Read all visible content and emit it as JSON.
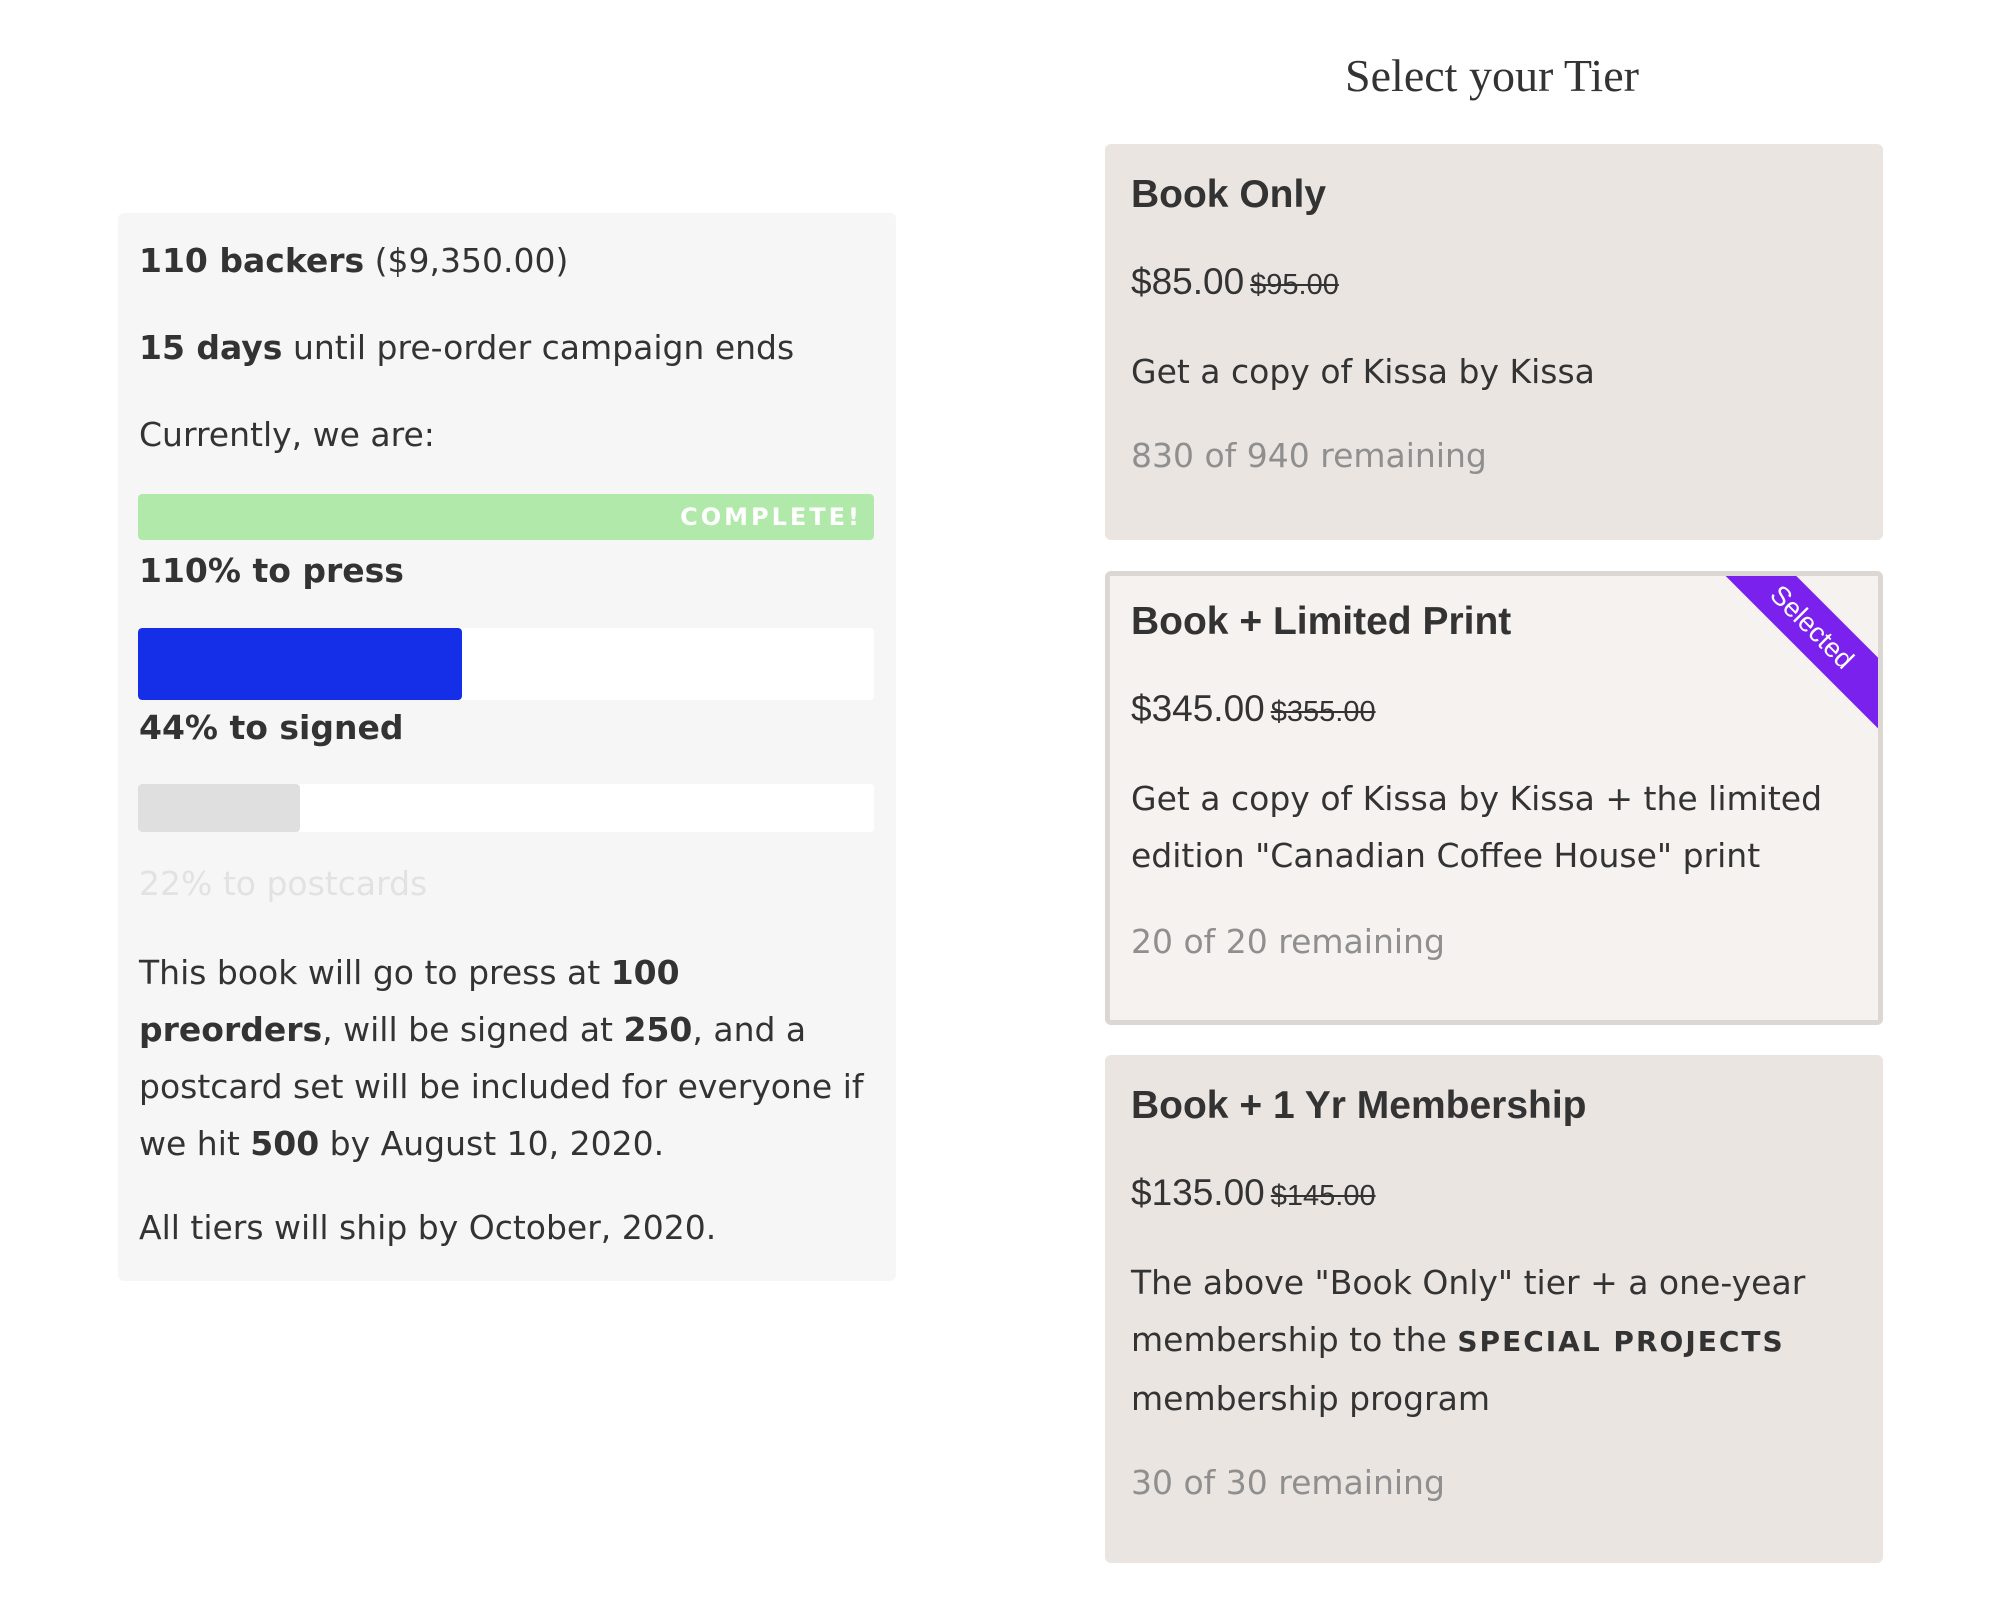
{
  "campaign": {
    "backers_count": "110 backers",
    "backers_amount": " ($9,350.00)",
    "days_count": "15 days",
    "days_text": " until pre-order campaign ends",
    "currently": "Currently, we are:",
    "progress": [
      {
        "id": "press",
        "caption": "110% to press",
        "percent": 110,
        "tag": "COMPLETE!",
        "color": "#b1e9ab"
      },
      {
        "id": "signed",
        "caption": "44% to signed",
        "percent": 44,
        "color": "#152ee8"
      },
      {
        "id": "postcards",
        "caption": "22% to postcards",
        "percent": 22,
        "color": "#dfdfdf"
      }
    ],
    "explain": {
      "t1": "This book will go to press at ",
      "b1": "100 preorders",
      "t2": ", will be signed at ",
      "b2": "250",
      "t3": ", and a postcard set will be included for everyone if we hit ",
      "b3": "500",
      "t4": " by August 10, 2020."
    },
    "shipping": "All tiers will ship by October, 2020."
  },
  "tiers": {
    "heading": "Select your Tier",
    "selected_label": "Selected",
    "selected_color": "#7a21ee",
    "items": [
      {
        "title": "Book Only",
        "price": "$85.00",
        "original_price": "$95.00",
        "description": "Get a copy of Kissa by Kissa",
        "remaining": "830 of 940 remaining",
        "selected": false
      },
      {
        "title": "Book + Limited Print",
        "price": "$345.00",
        "original_price": "$355.00",
        "description": "Get a copy of Kissa by Kissa + the limited edition \"Canadian Coffee House\" print",
        "remaining": "20 of 20 remaining",
        "selected": true
      },
      {
        "title": "Book + 1 Yr Membership",
        "price": "$135.00",
        "original_price": "$145.00",
        "description_pre": "The above \"Book Only\" tier + a one-year membership to the ",
        "description_emph": "SPECIAL PROJECTS",
        "description_post": " membership program",
        "remaining": "30 of 30 remaining",
        "selected": false
      }
    ]
  }
}
